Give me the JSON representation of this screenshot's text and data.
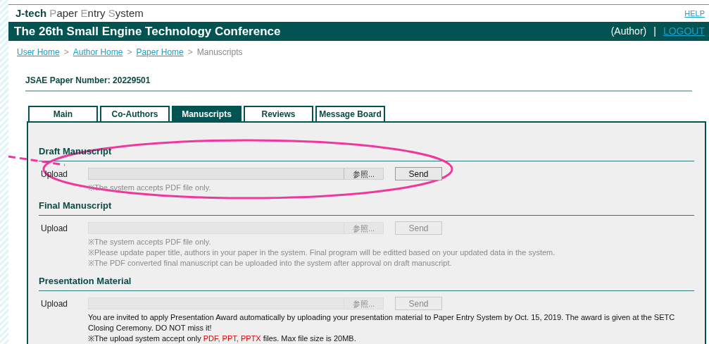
{
  "logo": {
    "parts": [
      {
        "text": "J-tech ",
        "kind": "brand"
      },
      {
        "text": "P",
        "kind": "accent"
      },
      {
        "text": "aper ",
        "kind": "plain"
      },
      {
        "text": "E",
        "kind": "accent"
      },
      {
        "text": "ntry ",
        "kind": "plain"
      },
      {
        "text": "S",
        "kind": "accent"
      },
      {
        "text": "ystem",
        "kind": "plain"
      }
    ]
  },
  "help_link": "HELP",
  "header": {
    "title": "The 26th Small Engine Technology Conference",
    "role": "(Author)",
    "separator": "|",
    "logout": "LOGOUT"
  },
  "breadcrumb": {
    "links": [
      "User Home",
      "Author Home",
      "Paper Home"
    ],
    "separator": ">",
    "current": "Manuscripts"
  },
  "paper_number": "JSAE Paper Number: 20229501",
  "tabs": [
    {
      "label": "Main",
      "selected": false
    },
    {
      "label": "Co-Authors",
      "selected": false
    },
    {
      "label": "Manuscripts",
      "selected": true
    },
    {
      "label": "Reviews",
      "selected": false
    },
    {
      "label": "Message Board",
      "selected": false
    }
  ],
  "sections": [
    {
      "title": "Draft Manuscript",
      "label": "Upload",
      "browse": "参照...",
      "send": "Send",
      "disabled": false,
      "notes": [
        {
          "kind": "muted",
          "parts": [
            {
              "text": "※The system accepts PDF file only.",
              "kind": "plain"
            }
          ]
        }
      ]
    },
    {
      "title": "Final Manuscript",
      "label": "Upload",
      "browse": "参照...",
      "send": "Send",
      "disabled": true,
      "notes": [
        {
          "kind": "muted",
          "parts": [
            {
              "text": "※The system accepts PDF file only.",
              "kind": "plain"
            }
          ]
        },
        {
          "kind": "muted",
          "parts": [
            {
              "text": "※Please update paper title, authors in your paper in the system. Final program will be editted based on your updated data in the system.",
              "kind": "plain"
            }
          ]
        },
        {
          "kind": "muted",
          "parts": [
            {
              "text": "※The PDF converted final manuscript can be uploaded into the system after approval on draft manuscript.",
              "kind": "plain"
            }
          ]
        }
      ]
    },
    {
      "title": "Presentation Material",
      "label": "Upload",
      "browse": "参照...",
      "send": "Send",
      "disabled": true,
      "notes": [
        {
          "kind": "plain",
          "parts": [
            {
              "text": "You are invited to apply Presentation Award automatically by uploading your presentation material to Paper Entry System by Oct. 15, 2019. The award is given at the SETC Closing Ceremony. DO NOT miss it!",
              "kind": "plain"
            }
          ]
        },
        {
          "kind": "plain",
          "parts": [
            {
              "text": "※The upload system accept only ",
              "kind": "plain"
            },
            {
              "text": "PDF, PPT, PPTX",
              "kind": "highlight"
            },
            {
              "text": " files. Max file size is 20MB.",
              "kind": "plain"
            }
          ]
        }
      ]
    }
  ]
}
